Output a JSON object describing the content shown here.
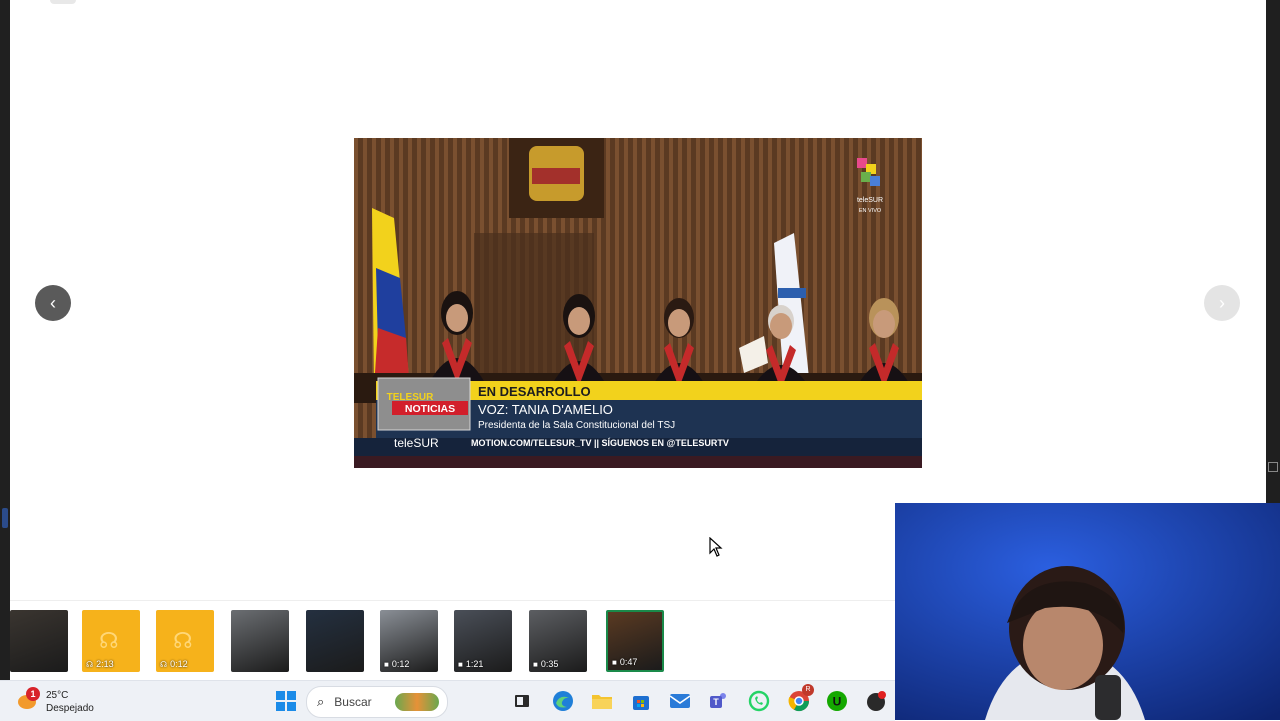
{
  "viewer": {
    "prev_label": "‹",
    "next_label": "›",
    "media": {
      "channel_logo": "teleSUR",
      "live_badge": "EN VIVO",
      "brand_box_top": "TELESUR",
      "brand_box_bottom": "NOTICIAS",
      "brand_footer": "teleSUR",
      "headline": "EN DESARROLLO",
      "subtitle_line1": "VOZ: TANIA D'AMELIO",
      "subtitle_line2": "Presidenta de la Sala Constitucional del TSJ",
      "ticker": "MOTION.COM/TELESUR_TV || SÍGUENOS EN @TELESURTV"
    }
  },
  "thumbnails": [
    {
      "type": "image",
      "duration": "",
      "color": "#3a3530"
    },
    {
      "type": "audio",
      "duration": "2:13",
      "color": "#f6b21b"
    },
    {
      "type": "audio",
      "duration": "0:12",
      "color": "#f6b21b"
    },
    {
      "type": "image",
      "duration": "",
      "color": "#6b6e72"
    },
    {
      "type": "image",
      "duration": "",
      "color": "#243040"
    },
    {
      "type": "video",
      "duration": "0:12",
      "color": "#8a8f96"
    },
    {
      "type": "video",
      "duration": "1:21",
      "color": "#4a4f58"
    },
    {
      "type": "video",
      "duration": "0:35",
      "color": "#5c5e62"
    },
    {
      "type": "video",
      "duration": "0:47",
      "color": "#5a3a22",
      "selected": true
    }
  ],
  "taskbar": {
    "weather_temp": "25°C",
    "weather_desc": "Despejado",
    "notification_count": "1",
    "search_placeholder": "Buscar",
    "chrome_badge": "R"
  },
  "colors": {
    "accent_green": "#1a8a4a",
    "telesur_yellow": "#f2d21c",
    "telesur_navy": "#1e3352",
    "webcam_blue": "#1c3fa8"
  }
}
